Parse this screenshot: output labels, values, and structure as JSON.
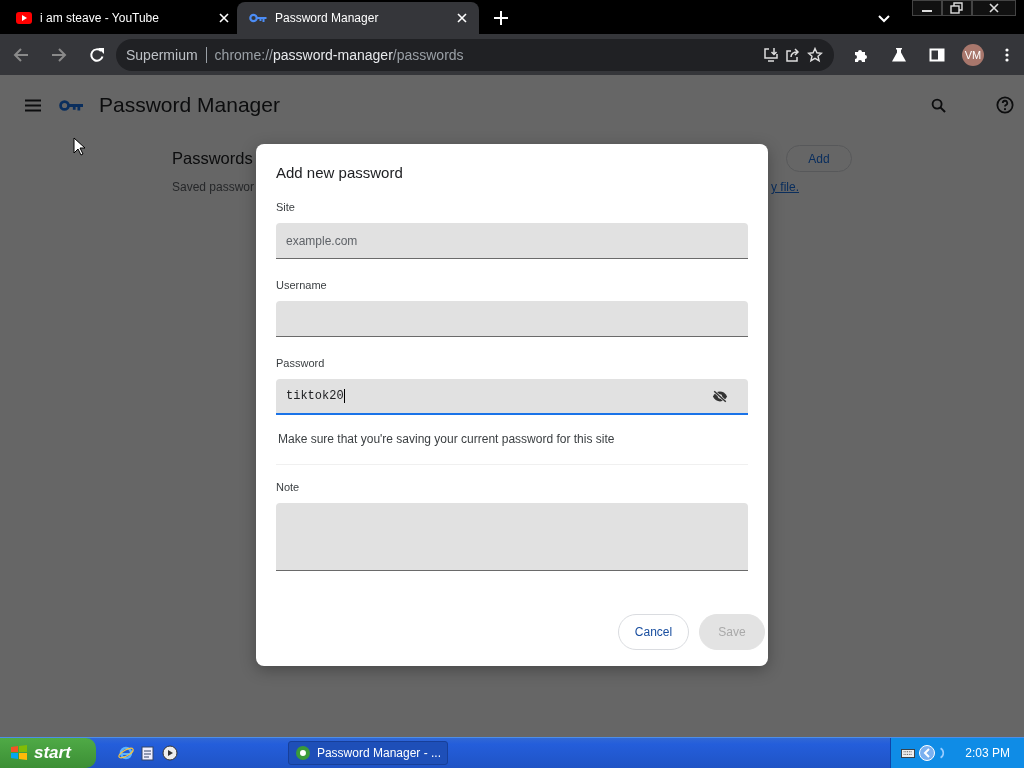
{
  "browser": {
    "tabs": [
      {
        "title": "i am steave - YouTube",
        "kind": "video",
        "selected": false
      },
      {
        "title": "Password Manager",
        "kind": "key",
        "selected": true
      }
    ],
    "address": {
      "app": "Supermium",
      "scheme": "chrome://",
      "host": "password-manager",
      "path": "/passwords"
    },
    "profile": "VM"
  },
  "page": {
    "title": "Password Manager",
    "section_title": "Passwords",
    "description": "Saved passwor",
    "link": "y file.",
    "add_button": "Add"
  },
  "dialog": {
    "title": "Add new password",
    "fields": [
      {
        "kind": "text",
        "label": "Site",
        "placeholder": "example.com",
        "focused": false
      },
      {
        "kind": "text",
        "label": "Username",
        "focused": false
      },
      {
        "kind": "password",
        "label": "Password",
        "value": "tiktok20",
        "focused": true
      },
      {
        "kind": "hint",
        "text": "Make sure that you're saving your current password for this site"
      },
      {
        "kind": "textarea",
        "label": "Note",
        "focused": false
      }
    ],
    "buttons": [
      {
        "label": "Cancel",
        "disabled": false
      },
      {
        "label": "Save",
        "disabled": true
      }
    ]
  },
  "taskbar": {
    "start": "start",
    "window": "Password Manager - ...",
    "clock": "2:03 PM"
  }
}
